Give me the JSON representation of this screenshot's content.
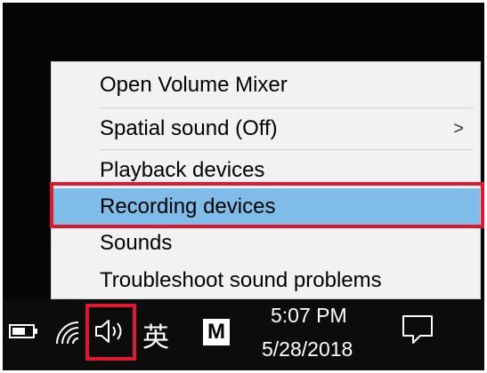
{
  "menu": {
    "items": [
      {
        "label": "Open Volume Mixer"
      },
      {
        "label": "Spatial sound (Off)",
        "submenu_glyph": ">"
      },
      {
        "label": "Playback devices"
      },
      {
        "label": "Recording devices"
      },
      {
        "label": "Sounds"
      },
      {
        "label": "Troubleshoot sound problems"
      }
    ],
    "highlighted_item": "Recording devices"
  },
  "taskbar": {
    "icons": [
      "battery-icon",
      "wifi-icon",
      "volume-icon",
      "ime-icon",
      "m-icon",
      "notification-icon"
    ],
    "ime_label": "英",
    "m_label": "M",
    "clock": {
      "time": "5:07 PM",
      "date": "5/28/2018"
    }
  },
  "colors": {
    "highlight": "#7fbde8",
    "callout_red": "#e0182d",
    "menu_bg": "#f2f2f2",
    "taskbar_bg": "#0c0c0c"
  }
}
